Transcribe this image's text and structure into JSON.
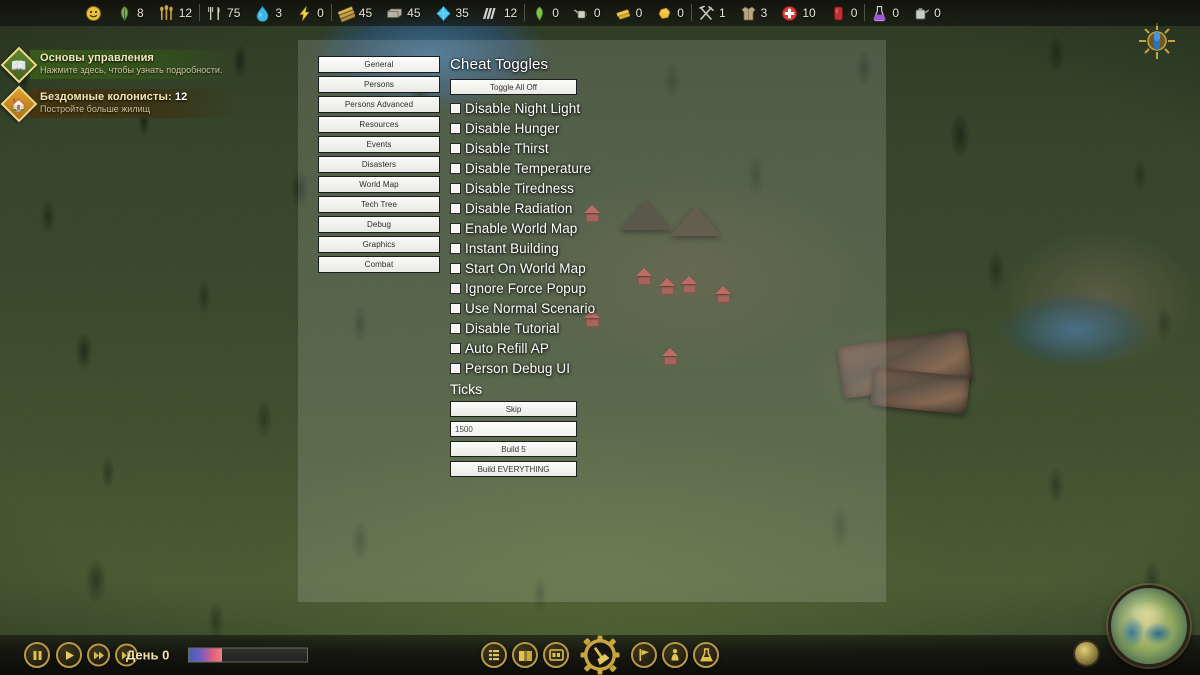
{
  "topbar": {
    "resources": [
      {
        "name": "happiness",
        "icon": "smiley-icon",
        "value": "",
        "color": "#e8c23a",
        "sep": false
      },
      {
        "name": "food",
        "icon": "leaf-food-icon",
        "value": "8",
        "color": "#7fae52",
        "sep": false
      },
      {
        "name": "crops",
        "icon": "wheat-icon",
        "value": "12",
        "color": "#c9a24a",
        "sep": false
      },
      {
        "name": "meals",
        "icon": "cutlery-icon",
        "value": "75",
        "color": "#d8d8cc",
        "sep": true
      },
      {
        "name": "water",
        "icon": "water-drop-icon",
        "value": "3",
        "color": "#3fb6e8",
        "sep": false
      },
      {
        "name": "energy",
        "icon": "lightning-bolt-icon",
        "value": "0",
        "color": "#f2d83a",
        "sep": false
      },
      {
        "name": "wood",
        "icon": "wood-planks-icon",
        "value": "45",
        "color": "#d7b45a",
        "sep": true
      },
      {
        "name": "stone",
        "icon": "stone-block-icon",
        "value": "45",
        "color": "#b6b2a4",
        "sep": false
      },
      {
        "name": "crystal",
        "icon": "crystal-gem-icon",
        "value": "35",
        "color": "#4fc7ef",
        "sep": false
      },
      {
        "name": "metal",
        "icon": "metal-bars-icon",
        "value": "12",
        "color": "#cfcfcf",
        "sep": false
      },
      {
        "name": "herbs",
        "icon": "green-herb-icon",
        "value": "0",
        "color": "#7cc24e",
        "sep": true
      },
      {
        "name": "fertilizer",
        "icon": "watering-can-icon",
        "value": "0",
        "color": "#cdd0c2",
        "sep": false
      },
      {
        "name": "gold-ingot",
        "icon": "gold-ingot-icon",
        "value": "0",
        "color": "#f0c94a",
        "sep": false
      },
      {
        "name": "gold-nugget",
        "icon": "gold-nugget-icon",
        "value": "0",
        "color": "#eec23c",
        "sep": false
      },
      {
        "name": "tools",
        "icon": "hammer-pick-icon",
        "value": "1",
        "color": "#cfcabb",
        "sep": true
      },
      {
        "name": "clothing",
        "icon": "clothing-icon",
        "value": "3",
        "color": "#b9a77e",
        "sep": false
      },
      {
        "name": "medicine",
        "icon": "red-cross-icon",
        "value": "10",
        "color": "#d63a3a",
        "sep": false
      },
      {
        "name": "blood",
        "icon": "blood-pack-icon",
        "value": "0",
        "color": "#c03030",
        "sep": false
      },
      {
        "name": "potion",
        "icon": "potion-flask-icon",
        "value": "0",
        "color": "#9a5ad8",
        "sep": true
      },
      {
        "name": "fuel",
        "icon": "fuel-canister-icon",
        "value": "0",
        "color": "#c8ccc4",
        "sep": false
      }
    ]
  },
  "notifications": [
    {
      "id": "tutorial-basics",
      "icon": "book-tutorial-icon",
      "style": "green",
      "title": "Основы управления",
      "subtitle": "Нажмите здесь, чтобы узнать подробности."
    },
    {
      "id": "homeless-colonists",
      "icon": "homeless-house-icon",
      "style": "amber",
      "title": "Бездомные колонисты:",
      "count": "12",
      "subtitle": "Постройте больше жилищ"
    }
  ],
  "cheat_menu": {
    "tabs": [
      {
        "label": "General",
        "active": true
      },
      {
        "label": "Persons",
        "active": false
      },
      {
        "label": "Persons Advanced",
        "active": false
      },
      {
        "label": "Resources",
        "active": false
      },
      {
        "label": "Events",
        "active": false
      },
      {
        "label": "Disasters",
        "active": false
      },
      {
        "label": "World Map",
        "active": false
      },
      {
        "label": "Tech Tree",
        "active": false
      },
      {
        "label": "Debug",
        "active": false
      },
      {
        "label": "Graphics",
        "active": false
      },
      {
        "label": "Combat",
        "active": false
      }
    ],
    "section_title": "Cheat Toggles",
    "toggle_all_label": "Toggle All Off",
    "toggles": [
      {
        "label": "Disable Night Light",
        "checked": false
      },
      {
        "label": "Disable Hunger",
        "checked": false
      },
      {
        "label": "Disable Thirst",
        "checked": false
      },
      {
        "label": "Disable Temperature",
        "checked": false
      },
      {
        "label": "Disable Tiredness",
        "checked": false
      },
      {
        "label": "Disable Radiation",
        "checked": false
      },
      {
        "label": "Enable World Map",
        "checked": false
      },
      {
        "label": "Instant Building",
        "checked": false
      },
      {
        "label": "Start On World Map",
        "checked": false
      },
      {
        "label": "Ignore Force Popup",
        "checked": false
      },
      {
        "label": "Use Normal Scenario",
        "checked": false
      },
      {
        "label": "Disable Tutorial",
        "checked": false
      },
      {
        "label": "Auto Refill AP",
        "checked": false
      },
      {
        "label": "Person Debug UI",
        "checked": false
      }
    ],
    "ticks_title": "Ticks",
    "skip_label": "Skip",
    "ticks_value": "1500",
    "build5_label": "Build 5",
    "build_everything_label": "Build EVERYTHING"
  },
  "bottombar": {
    "speed_buttons": [
      {
        "name": "pause-button",
        "glyph": "❚❚"
      },
      {
        "name": "play-button",
        "glyph": "▶"
      },
      {
        "name": "fast-forward-button",
        "glyph": "▶▶"
      },
      {
        "name": "ultra-speed-button",
        "glyph": "▶▶"
      }
    ],
    "day_label": "День 0",
    "day_progress_percent": "28",
    "tools_left": [
      {
        "name": "list-overview-button",
        "glyph": "≣"
      },
      {
        "name": "colonists-book-button",
        "glyph": "▥"
      },
      {
        "name": "inventory-button",
        "glyph": "◫"
      }
    ],
    "build_button": {
      "name": "build-gear-button",
      "glyph": "⚒"
    },
    "tools_right": [
      {
        "name": "expedition-flag-button",
        "glyph": "⚑"
      },
      {
        "name": "production-button",
        "glyph": "♟"
      },
      {
        "name": "research-flask-button",
        "glyph": "⚗"
      }
    ],
    "minimap_name": "world-globe-minimap",
    "minimap_small_name": "local-minimap"
  },
  "colors": {
    "accent_gold": "#e0c24e",
    "panel_light": "#f4f4f0",
    "notif_green": "#3a5c1c",
    "notif_amber": "#463414",
    "text_white": "#ffffff"
  }
}
